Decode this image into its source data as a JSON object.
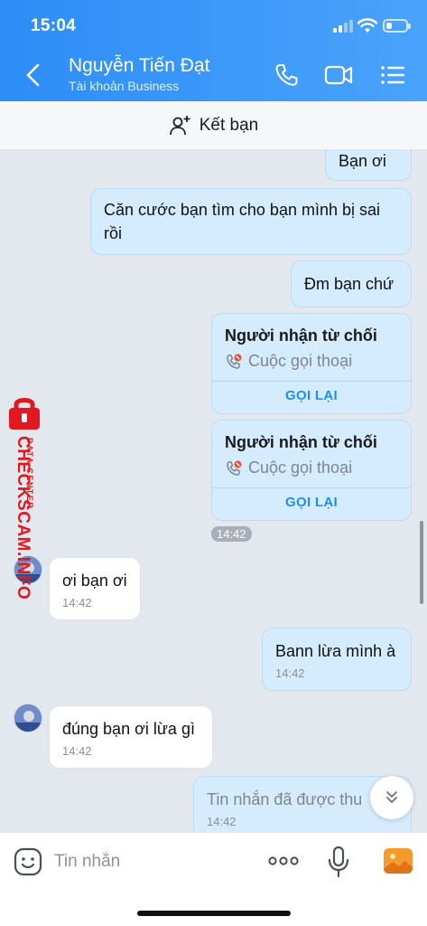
{
  "status_bar": {
    "time": "15:04",
    "battery_level": 0.2
  },
  "header": {
    "name": "Nguyễn Tiến Đạt",
    "subtitle": "Tài khoản Business",
    "icons": [
      "back-chevron-icon",
      "phone-icon",
      "video-camera-icon",
      "menu-list-icon"
    ]
  },
  "add_friend": {
    "label": "Kết bạn",
    "icon": "add-person-icon"
  },
  "messages": {
    "m1": {
      "text": "Bạn ơi"
    },
    "m2": {
      "text": "Căn cước bạn tìm cho bạn mình bị sai rồi"
    },
    "m3": {
      "text": "Đm bạn chứ"
    },
    "call1": {
      "title": "Người nhận từ chối",
      "subtitle": "Cuộc gọi thoại",
      "action": "GỌI LẠI"
    },
    "call2": {
      "title": "Người nhận từ chối",
      "subtitle": "Cuộc gọi thoại",
      "action": "GỌI LẠI"
    },
    "call_time": "14:42",
    "m4": {
      "text": "ơi bạn ơi",
      "time": "14:42"
    },
    "m5": {
      "text": "Bann lừa mình à",
      "time": "14:42"
    },
    "m6": {
      "text": "đúng bạn ơi lừa gì",
      "time": "14:42"
    },
    "m7": {
      "text": "Tin nhắn đã được thu",
      "time": "14:42"
    }
  },
  "watermark": {
    "main": "CHECKSCAM.INFO",
    "sub": "DATA CENTER"
  },
  "composer": {
    "placeholder": "Tin nhắn",
    "icons": [
      "emoji-icon",
      "more-dots-icon",
      "microphone-icon",
      "photo-icon"
    ]
  },
  "colors": {
    "header_start": "#2d8df7",
    "header_end": "#4aa3fb",
    "outgoing_bubble": "#d5ecfe",
    "link": "#1f8ef1",
    "watermark": "#e1181f"
  }
}
